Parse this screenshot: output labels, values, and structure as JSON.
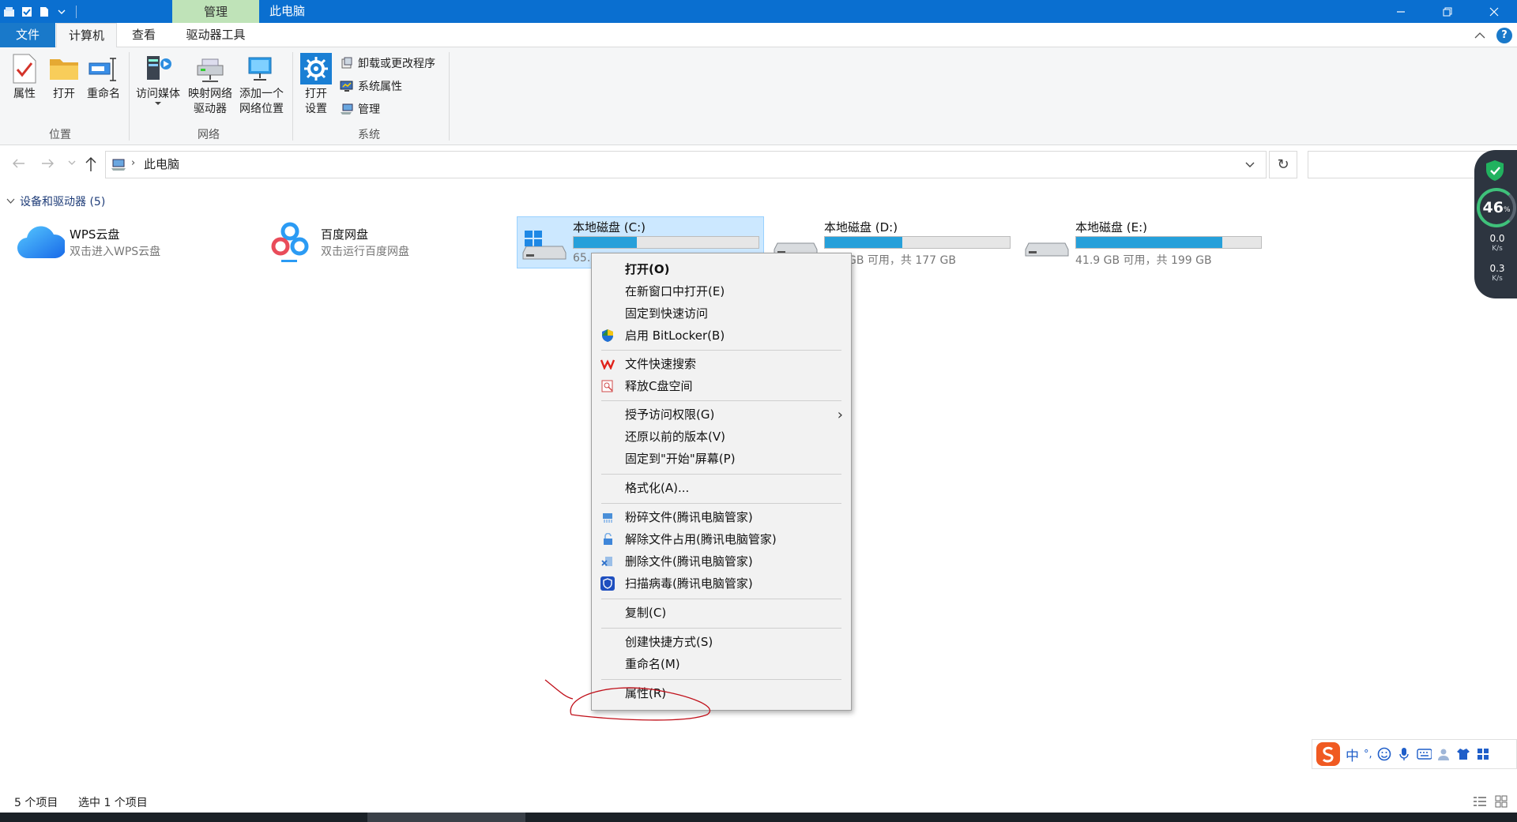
{
  "titlebar": {
    "title": "此电脑",
    "context_tab": "管理"
  },
  "tabs": [
    {
      "label": "文件"
    },
    {
      "label": "计算机"
    },
    {
      "label": "查看"
    },
    {
      "label": "驱动器工具"
    }
  ],
  "ribbon": {
    "location": {
      "properties": "属性",
      "open": "打开",
      "rename": "重命名",
      "group": "位置"
    },
    "network": {
      "media_line1": "访问媒体",
      "map_line1": "映射网络",
      "map_line2": "驱动器",
      "add_line1": "添加一个",
      "add_line2": "网络位置",
      "group": "网络"
    },
    "system": {
      "settings_line1": "打开",
      "settings_line2": "设置",
      "uninstall": "卸载或更改程序",
      "sysprops": "系统属性",
      "manage": "管理",
      "group": "系统"
    }
  },
  "address": {
    "path": "此电脑"
  },
  "group_header": {
    "label": "设备和驱动器 (5)"
  },
  "items": [
    {
      "name": "WPS云盘",
      "sub": "双击进入WPS云盘"
    },
    {
      "name": "百度网盘",
      "sub": "双击运行百度网盘"
    },
    {
      "name": "本地磁盘 (C:)",
      "sub": "65.",
      "used_fraction": 0.34
    },
    {
      "name": "本地磁盘 (D:)",
      "sub": "GB 可用，共 177 GB",
      "used_fraction": 0.42
    },
    {
      "name": "本地磁盘 (E:)",
      "sub": "41.9 GB 可用，共 199 GB",
      "used_fraction": 0.79
    }
  ],
  "context_menu": {
    "open": "打开(O)",
    "open_new_window": "在新窗口中打开(E)",
    "pin_quick": "固定到快速访问",
    "bitlocker": "启用 BitLocker(B)",
    "quick_search": "文件快速搜索",
    "free_c": "释放C盘空间",
    "grant_access": "授予访问权限(G)",
    "restore_prev": "还原以前的版本(V)",
    "pin_start": "固定到\"开始\"屏幕(P)",
    "format": "格式化(A)...",
    "shred": "粉碎文件(腾讯电脑管家)",
    "unlock": "解除文件占用(腾讯电脑管家)",
    "delete": "删除文件(腾讯电脑管家)",
    "scan": "扫描病毒(腾讯电脑管家)",
    "copy": "复制(C)",
    "shortcut": "创建快捷方式(S)",
    "rename": "重命名(M)",
    "properties": "属性(R)"
  },
  "status": {
    "count": "5 个项目",
    "selected": "选中 1 个项目"
  },
  "widget": {
    "percent": "46",
    "percent_unit": "%",
    "up": "0.0",
    "down": "0.3",
    "unit": "K/s"
  },
  "ime": {
    "lang": "中",
    "punct": "°,"
  },
  "colors": {
    "title_bar": "#0a6fd0",
    "accent": "#1979ca",
    "selection": "#cce8ff",
    "drive_bar": "#26a0da",
    "annotation": "#c0101a"
  }
}
